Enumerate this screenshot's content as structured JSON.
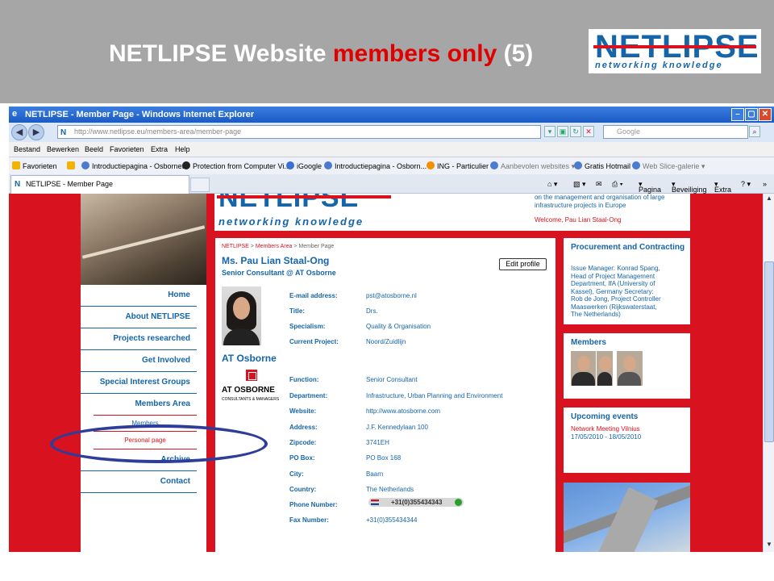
{
  "slide": {
    "title_part1": "NETLIPSE Website",
    "title_red": "members only",
    "title_part2": "(5)",
    "logo_word": "NETLIPSE",
    "logo_sub": "networking knowledge"
  },
  "browser": {
    "window_title": "NETLIPSE - Member Page - Windows Internet Explorer",
    "url": "http://www.netlipse.eu/members-area/member-page",
    "search_placeholder": "Google",
    "menu": [
      "Bestand",
      "Bewerken",
      "Beeld",
      "Favorieten",
      "Extra",
      "Help"
    ],
    "favorites_label": "Favorieten",
    "favorites": [
      "Introductiepagina - Osbornet",
      "Protection from Computer Vi...",
      "iGoogle",
      "Introductiepagina - Osborn...",
      "ING - Particulier",
      "Aanbevolen websites",
      "Gratis Hotmail",
      "Web Slice-galerie"
    ],
    "tab_label": "NETLIPSE - Member Page",
    "tools": [
      "Pagina",
      "Beveiliging",
      "Extra"
    ],
    "colors": {
      "chrome_blue": "#1a5bc4",
      "site_red": "#d8121e",
      "site_blue": "#1565a8"
    }
  },
  "site": {
    "logo_word": "NETLIPSE",
    "logo_sub": "networking knowledge",
    "tagline": "on the management and organisation of large infrastructure projects in Europe",
    "welcome": "Welcome, Pau Lian Staal-Ong"
  },
  "nav": {
    "items": [
      "Home",
      "About NETLIPSE",
      "Projects researched",
      "Get Involved",
      "Special Interest Groups",
      "Members Area"
    ],
    "sub_items": [
      "Members",
      "Personal page"
    ],
    "after": [
      "Archive",
      "Contact"
    ]
  },
  "breadcrumb": {
    "home": "NETLIPSE",
    "sep1": " > ",
    "area": "Members Area",
    "sep2": " > ",
    "current": "Member Page"
  },
  "member": {
    "name": "Ms. Pau Lian Staal-Ong",
    "role": "Senior Consultant @ AT Osborne",
    "edit_label": "Edit profile",
    "company": "AT Osborne",
    "company_logo_word": "AT OSBORNE",
    "company_logo_sub": "CONSULTANTS & MANAGERS",
    "fields_top": [
      {
        "label": "E-mail address:",
        "value": "pst@atosborne.nl"
      },
      {
        "label": "Title:",
        "value": "Drs."
      },
      {
        "label": "Specialism:",
        "value": "Quality & Organisation"
      },
      {
        "label": "Current Project:",
        "value": "Noord/Zuidlijn"
      }
    ],
    "fields_bottom": [
      {
        "label": "Function:",
        "value": "Senior Consultant"
      },
      {
        "label": "Department:",
        "value": "Infrastructure, Urban Planning and Environment"
      },
      {
        "label": "Website:",
        "value": "http://www.atosborne.com"
      },
      {
        "label": "Address:",
        "value": "J.F. Kennedylaan 100"
      },
      {
        "label": "Zipcode:",
        "value": "3741EH"
      },
      {
        "label": "PO Box:",
        "value": "PO Box 168"
      },
      {
        "label": "City:",
        "value": "Baarn"
      },
      {
        "label": "Country:",
        "value": "The Netherlands"
      },
      {
        "label": "Phone Number:",
        "value": "+31(0)355434343"
      },
      {
        "label": "Fax Number:",
        "value": "+31(0)355434344"
      }
    ]
  },
  "right": {
    "procurement_title": "Procurement and Contracting",
    "procurement_lines": [
      "Issue Manager: Konrad Spang,",
      "Head of Project Management",
      "Department, IfA (University of",
      "Kassel), Germany Secretary:",
      "Rob de Jong, Project Controller",
      "Maaswerken (Rijkswaterstaat,",
      "The Netherlands)"
    ],
    "members_title": "Members",
    "events_title": "Upcoming events",
    "event_name": "Network Meeting Vilnius",
    "event_dates": "17/05/2010 - 18/05/2010"
  }
}
